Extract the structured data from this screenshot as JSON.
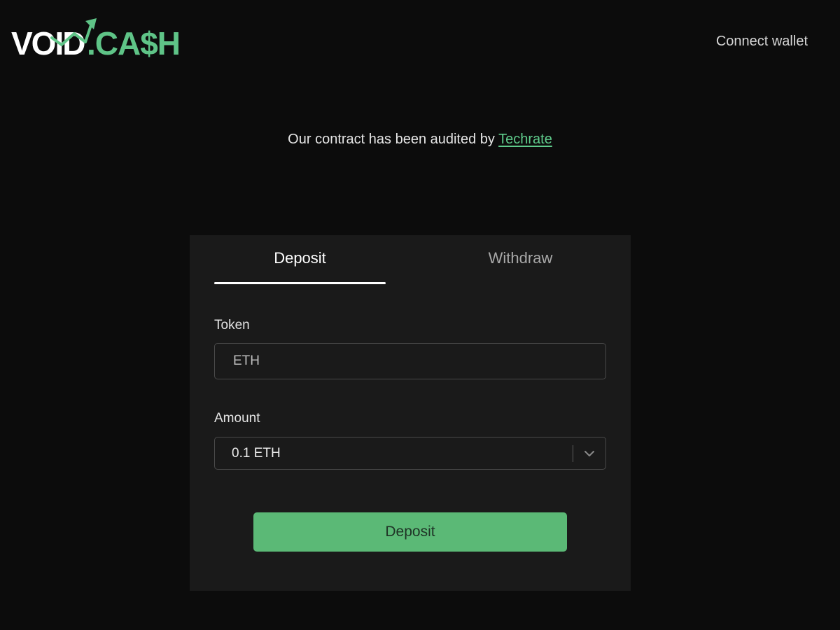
{
  "header": {
    "logo_text_1": "VOID",
    "logo_text_2": ".CA$H",
    "connect_label": "Connect wallet"
  },
  "audit": {
    "text": "Our contract has been audited by ",
    "link_label": "Techrate"
  },
  "card": {
    "tabs": [
      {
        "label": "Deposit",
        "active": true
      },
      {
        "label": "Withdraw",
        "active": false
      }
    ],
    "token_label": "Token",
    "token_value": "ETH",
    "amount_label": "Amount",
    "amount_value": "0.1 ETH",
    "submit_label": "Deposit"
  },
  "colors": {
    "background": "#0c0c0c",
    "card": "#1a1a1a",
    "accent_green": "#5bb976",
    "link_green": "#5fcb8b"
  }
}
